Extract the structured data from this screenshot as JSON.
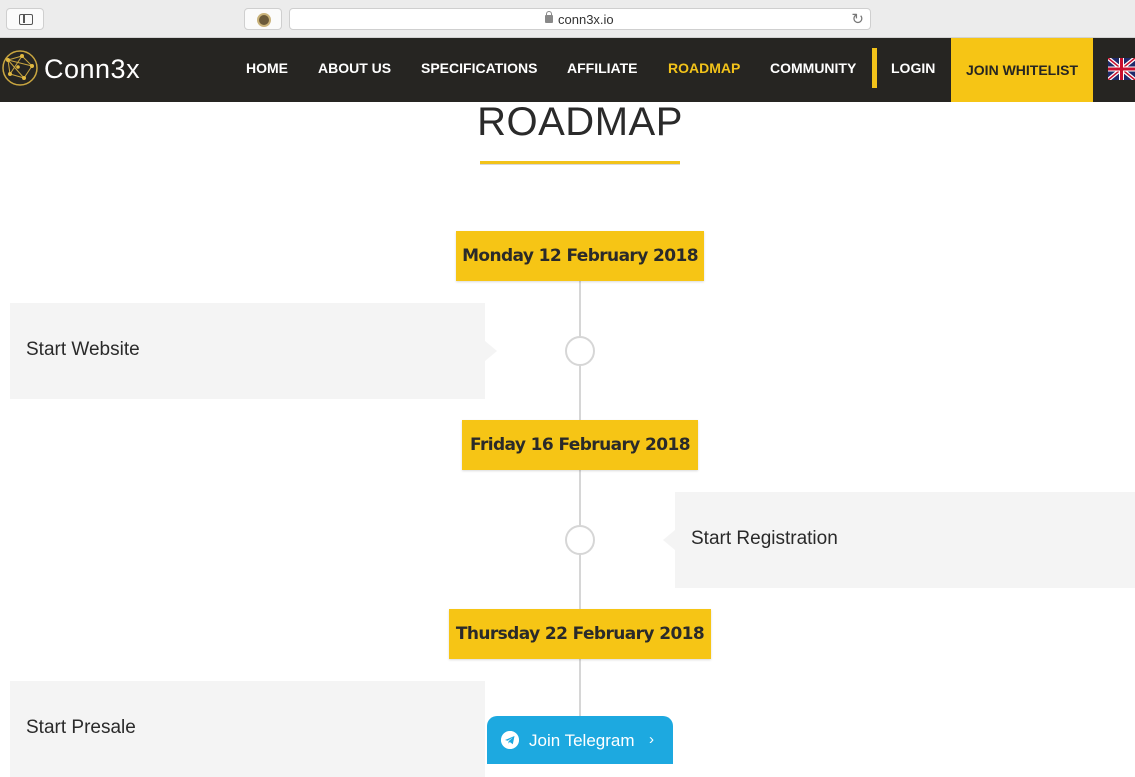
{
  "browser": {
    "url": "conn3x.io",
    "reload_icon": "reload-icon",
    "lock_icon": "lock-icon",
    "sidebar_icon": "sidebar-icon",
    "extension_icon": "extension-icon"
  },
  "nav": {
    "brand": "Conn3x",
    "links": [
      {
        "label": "HOME"
      },
      {
        "label": "ABOUT US"
      },
      {
        "label": "SPECIFICATIONS"
      },
      {
        "label": "AFFILIATE"
      },
      {
        "label": "ROADMAP",
        "active": true
      },
      {
        "label": "COMMUNITY"
      },
      {
        "label": "LOGIN"
      }
    ],
    "cta": "JOIN WHITELIST",
    "language_icon": "uk-flag-icon"
  },
  "page": {
    "title": "ROADMAP"
  },
  "timeline": [
    {
      "date": "Monday 12 February 2018",
      "event": "Start Website",
      "side": "left"
    },
    {
      "date": "Friday 16 February 2018",
      "event": "Start Registration",
      "side": "right"
    },
    {
      "date": "Thursday 22 February 2018",
      "event": "Start Presale",
      "side": "left"
    }
  ],
  "telegram": {
    "label": "Join Telegram",
    "chevron": "›"
  },
  "colors": {
    "accent": "#f6c515",
    "nav_bg": "#262522",
    "telegram": "#1da9e0"
  }
}
